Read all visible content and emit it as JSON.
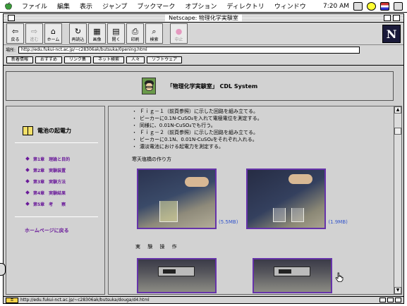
{
  "menubar": {
    "items": [
      "ファイル",
      "編集",
      "表示",
      "ジャンプ",
      "ブックマーク",
      "オプション",
      "ディレクトリ",
      "ウィンドウ"
    ],
    "clock": "7:20 AM"
  },
  "window": {
    "title": "Netscape: 物理化学実験室"
  },
  "toolbar": {
    "buttons": [
      {
        "label": "戻る",
        "icon": "back-arrow-icon",
        "glyph": "⇦"
      },
      {
        "label": "進む",
        "icon": "forward-arrow-icon",
        "glyph": "⇨"
      },
      {
        "label": "ホーム",
        "icon": "home-icon",
        "glyph": "⌂"
      },
      {
        "label": "再読込",
        "icon": "reload-icon",
        "glyph": "↻"
      },
      {
        "label": "画像",
        "icon": "images-icon",
        "glyph": "▦"
      },
      {
        "label": "開く",
        "icon": "open-icon",
        "glyph": "▤"
      },
      {
        "label": "印刷",
        "icon": "print-icon",
        "glyph": "⎙"
      },
      {
        "label": "検索",
        "icon": "find-icon",
        "glyph": "⌕"
      },
      {
        "label": "中止",
        "icon": "stop-icon",
        "glyph": "●"
      }
    ]
  },
  "location": {
    "label": "場所:",
    "url": "http://edu.fukui-nct.ac.jp/~c28306ak/butsuka/0pening.html"
  },
  "directory_buttons": [
    "新着情報",
    "おすすめ",
    "リンク集",
    "ネット検索",
    "人々",
    "ソフトウェア"
  ],
  "banner": {
    "title": "「物理化学実験室」 CDL System"
  },
  "left_frame": {
    "title": "電池の起電力",
    "chapters": [
      "第1章　理論と目的",
      "第2章　実験装置",
      "第3章　実験方法",
      "第4章　実験結果",
      "第5章　考　　察"
    ],
    "home_link": "ホームページに戻る"
  },
  "main_frame": {
    "steps": [
      "Ｆｉｇ－１（前頁参照）に示した回路を組み立てる。",
      "ビーカーに0.1N-CuSO₄を入れて電極電位を測定する。",
      "同様に、0.01N-CuSO₄でも行う。",
      "Ｆｉｇ－２（前頁参照）に示した回路を組み立てる。",
      "ビーカーに0.1N、0.01N-CuSO₄をそれぞれ入れる。",
      "濃淡電池における起電力を測定する。"
    ],
    "section1_title": "寒天塩橋の作り方",
    "video1_size": "(5.5MB)",
    "video2_size": "(1.9MB)",
    "section2_title": "実 験 操 作"
  },
  "status": {
    "url": "http://edu.fukui-nct.ac.jp/~c28306ak/butsuka/douga/d4.html"
  },
  "colors": {
    "link": "#6a1a9a",
    "video_link": "#3355cc",
    "photo_border": "#6633aa"
  }
}
